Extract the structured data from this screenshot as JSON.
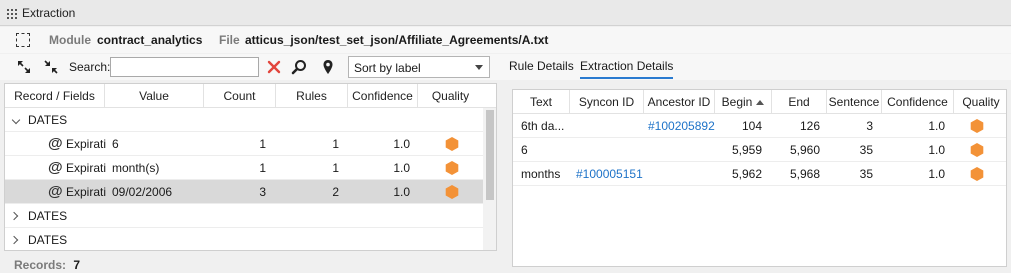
{
  "window": {
    "title": "Extraction"
  },
  "info": {
    "module_label": "Module",
    "module_value": "contract_analytics",
    "file_label": "File",
    "file_value": "atticus_json/test_set_json/Affiliate_Agreements/A.txt"
  },
  "toolbar": {
    "expand_icon": "expand-arrows-icon",
    "collapse_icon": "collapse-arrows-icon",
    "search_label": "Search:",
    "search_value": "",
    "search_placeholder": "",
    "sort_value": "Sort by label"
  },
  "left_table": {
    "headers": [
      "Record / Fields",
      "Value",
      "Count",
      "Rules",
      "Confidence",
      "Quality"
    ],
    "rows": [
      {
        "kind": "group",
        "label": "DATES",
        "expanded": true
      },
      {
        "kind": "field",
        "label": "Expirati",
        "value": "6",
        "count": "1",
        "rules": "1",
        "confidence": "1.0",
        "quality_color": "#f39237"
      },
      {
        "kind": "field",
        "label": "Expirati",
        "value": "month(s)",
        "count": "1",
        "rules": "1",
        "confidence": "1.0",
        "quality_color": "#f39237"
      },
      {
        "kind": "field",
        "label": "Expirati",
        "value": "09/02/2006",
        "count": "3",
        "rules": "2",
        "confidence": "1.0",
        "quality_color": "#f39237",
        "selected": true
      },
      {
        "kind": "group",
        "label": "DATES",
        "expanded": false
      },
      {
        "kind": "group",
        "label": "DATES",
        "expanded": false
      }
    ]
  },
  "status": {
    "records_label": "Records:",
    "records_value": "7"
  },
  "right_tabs": [
    {
      "label": "Rule Details",
      "active": false
    },
    {
      "label": "Extraction Details",
      "active": true
    }
  ],
  "right_table": {
    "headers": [
      "Text",
      "Syncon ID",
      "Ancestor ID",
      "Begin",
      "End",
      "Sentence",
      "Confidence",
      "Quality"
    ],
    "sorted_column": "Begin",
    "rows": [
      {
        "text": "6th da...",
        "syncon": "",
        "ancestor": "#100205892",
        "begin": "104",
        "end": "126",
        "sentence": "3",
        "confidence": "1.0",
        "quality_color": "#f39237"
      },
      {
        "text": "6",
        "syncon": "",
        "ancestor": "",
        "begin": "5,959",
        "end": "5,960",
        "sentence": "35",
        "confidence": "1.0",
        "quality_color": "#f39237"
      },
      {
        "text": "months",
        "syncon": "#100005151",
        "ancestor": "",
        "begin": "5,962",
        "end": "5,968",
        "sentence": "35",
        "confidence": "1.0",
        "quality_color": "#f39237"
      }
    ]
  }
}
